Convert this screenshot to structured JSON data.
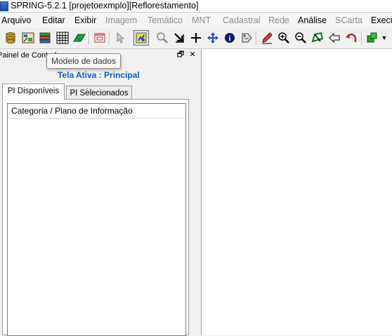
{
  "window": {
    "title": "SPRING-5.2.1 [projetoexmplo][Reflorestamento]"
  },
  "menu": {
    "items": [
      {
        "label": "Arquivo",
        "enabled": true
      },
      {
        "label": "Editar",
        "enabled": true
      },
      {
        "label": "Exibir",
        "enabled": true
      },
      {
        "label": "Imagem",
        "enabled": false
      },
      {
        "label": "Temático",
        "enabled": false
      },
      {
        "label": "MNT",
        "enabled": false
      },
      {
        "label": "Cadastral",
        "enabled": false
      },
      {
        "label": "Rede",
        "enabled": false
      },
      {
        "label": "Análise",
        "enabled": true
      },
      {
        "label": "SCarta",
        "enabled": false
      },
      {
        "label": "Execu",
        "enabled": true
      }
    ]
  },
  "toolbar": {
    "icons": [
      "database-icon",
      "projection-icon",
      "data-model-icon",
      "grid-icon",
      "draw-shape-icon",
      "window-icon",
      "pointer-icon",
      "view-icon",
      "zoom-icon",
      "arrow-down-right-icon",
      "crosshair-icon",
      "pan-icon",
      "info-icon",
      "select-tag-icon",
      "pencil-icon",
      "zoom-in-icon",
      "zoom-out-icon",
      "polygon-icon",
      "back-icon",
      "undo-icon",
      "layer-icon"
    ]
  },
  "panel": {
    "title": "Painel de Controle",
    "tooltip": "Modelo de dados",
    "active_screen": "Tela Ativa : Principal",
    "tabs": [
      {
        "label": "PI Disponíveis",
        "selected": true
      },
      {
        "label": "PI Selecionados",
        "selected": false
      }
    ],
    "list_header": "Categoria / Plano de Informação",
    "restore_glyph": "🗗",
    "close_glyph": "✕"
  },
  "colors": {
    "accent": "#0a5bd6"
  }
}
